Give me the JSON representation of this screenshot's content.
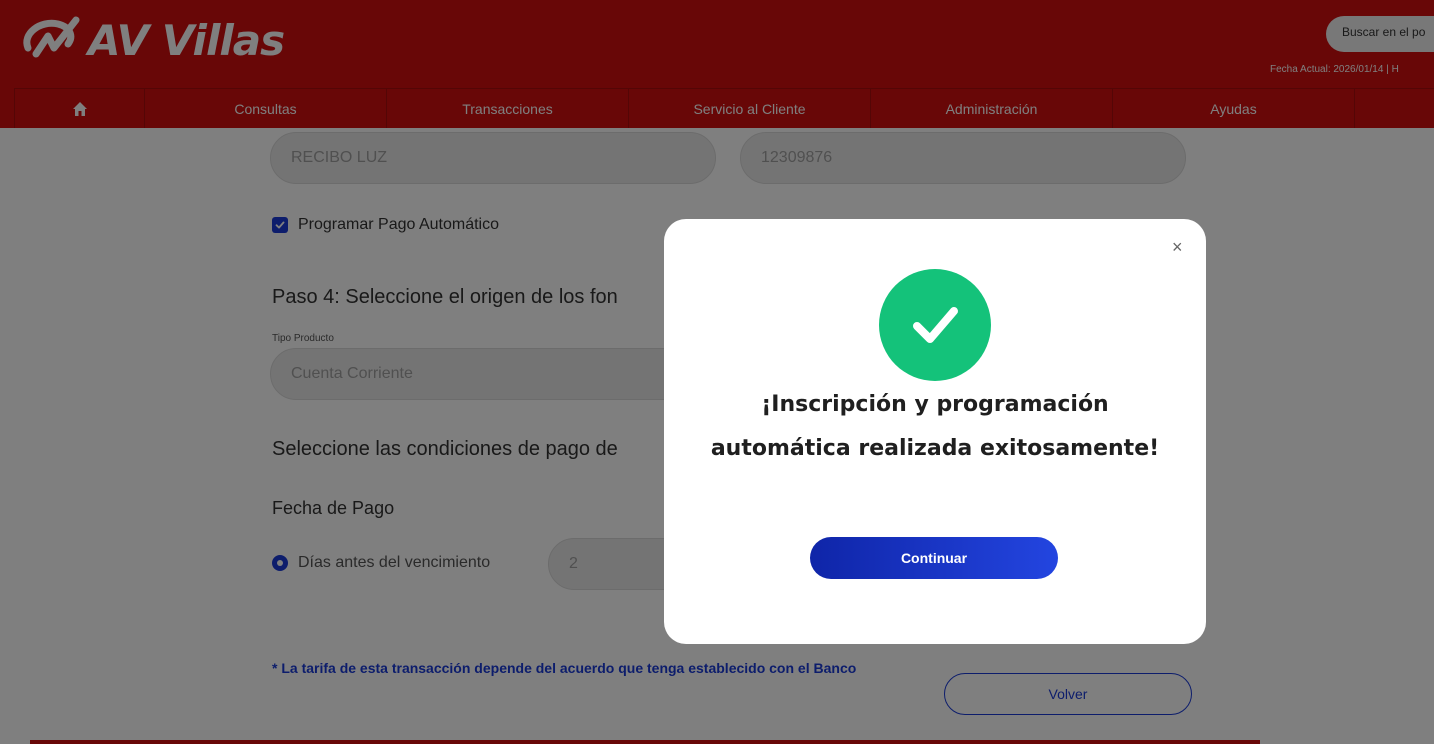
{
  "brand": {
    "name": "AV Villas"
  },
  "header": {
    "search_placeholder": "Buscar en el po",
    "date_line": "Fecha Actual: 2026/01/14 | H"
  },
  "nav": {
    "home_icon": "home-icon",
    "items": [
      {
        "label": "Consultas"
      },
      {
        "label": "Transacciones"
      },
      {
        "label": "Servicio al Cliente"
      },
      {
        "label": "Administración"
      },
      {
        "label": "Ayudas"
      }
    ]
  },
  "form": {
    "reference_value": "RECIBO LUZ",
    "number_value": "12309876",
    "auto_pay_label": "Programar Pago Automático",
    "auto_pay_checked": true,
    "step4_title": "Paso 4: Seleccione el origen de los fon",
    "product_type_label": "Tipo Producto",
    "product_type_value": "Cuenta Corriente",
    "conditions_title": "Seleccione las condiciones de pago de",
    "payment_date_title": "Fecha de Pago",
    "days_before_label": "Días antes del vencimiento",
    "days_before_value": "2",
    "fee_note": "* La tarifa de esta transacción depende del acuerdo que tenga establecido con el Banco",
    "back_button": "Volver"
  },
  "modal": {
    "close_symbol": "×",
    "icon": "check-circle-icon",
    "message": "¡Inscripción y programación automática realizada exitosamente!",
    "continue_button": "Continuar"
  },
  "colors": {
    "brand_red": "#d10f0f",
    "accent_blue": "#1a3bd8",
    "success_green": "#14c27a"
  }
}
